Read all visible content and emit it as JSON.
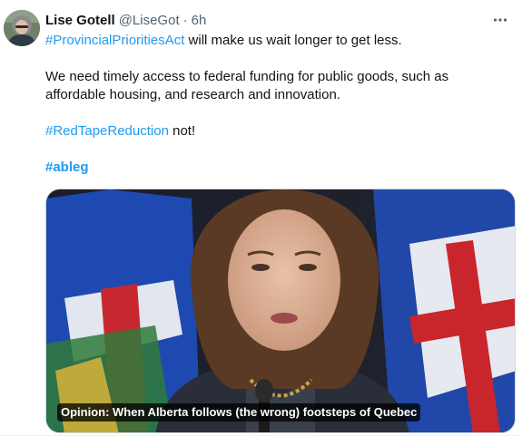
{
  "tweet": {
    "author_name": "Lise Gotell",
    "author_handle": "@LiseGot",
    "separator": "·",
    "timestamp": "6h",
    "more_icon": "more-horizontal-icon",
    "body": {
      "line1_hashtag": "#ProvincialPrioritiesAct",
      "line1_rest": " will make us wait longer to get less.",
      "para2": "We need timely access to federal funding for public goods, such as affordable housing, and research and innovation.",
      "line3_hashtag": "#RedTapeReduction",
      "line3_rest": " not!",
      "line4_hashtag": "#ableg"
    },
    "card": {
      "caption": "Opinion: When Alberta follows (the wrong) footsteps of Quebec"
    }
  },
  "colors": {
    "link": "#1d9bf0",
    "secondary_text": "#536471",
    "primary_text": "#0f1419",
    "border": "#cfd9de"
  }
}
